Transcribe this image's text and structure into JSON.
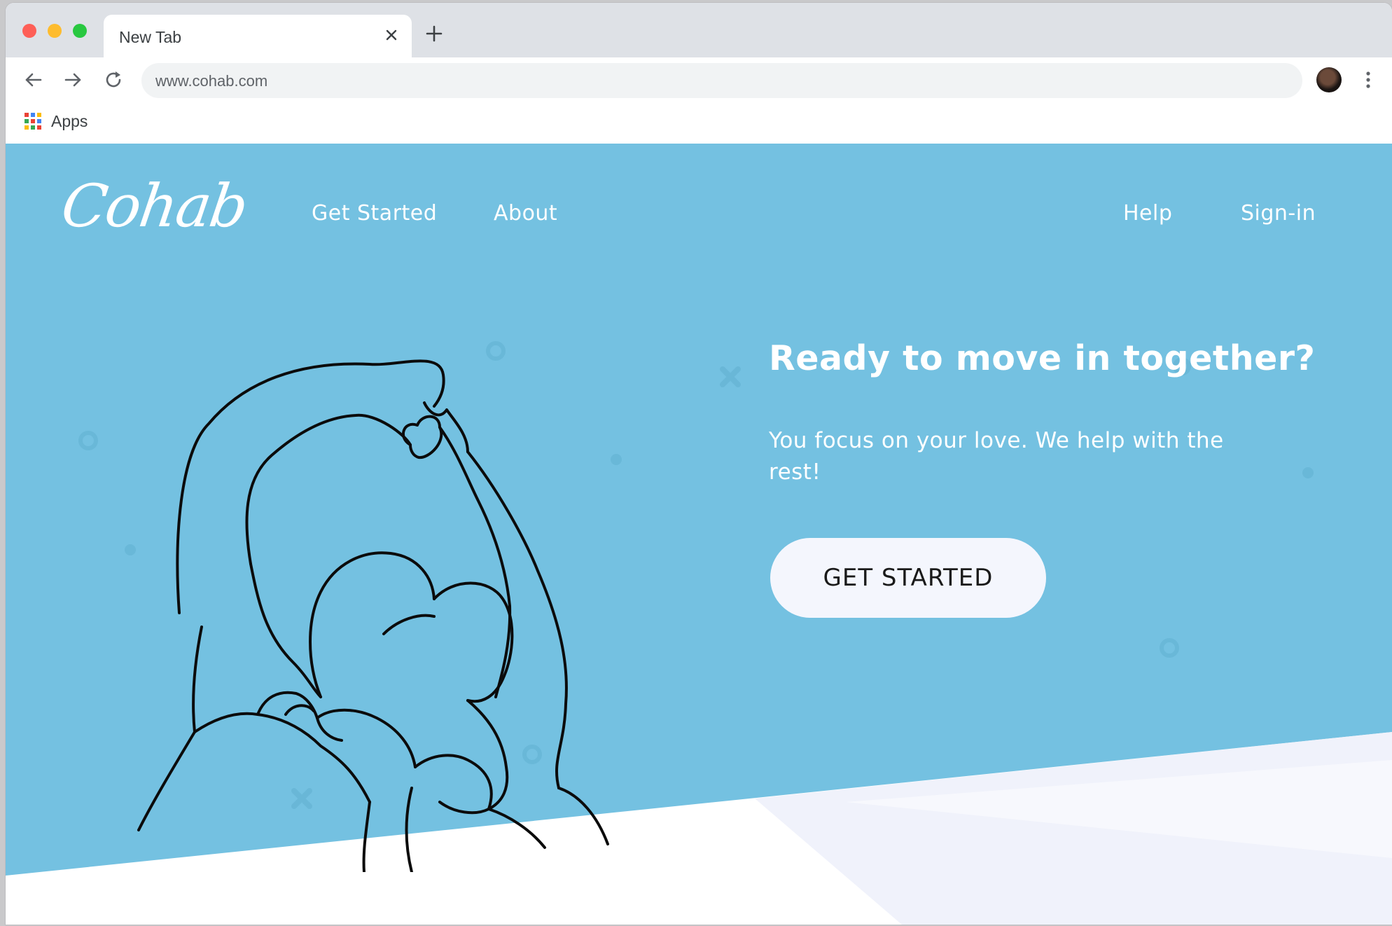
{
  "browser": {
    "tab_title": "New Tab",
    "url": "www.cohab.com",
    "bookmarks_label": "Apps"
  },
  "site": {
    "logo": "Cohab",
    "nav": {
      "get_started": "Get Started",
      "about": "About",
      "help": "Help",
      "sign_in": "Sign-in"
    },
    "hero": {
      "headline": "Ready to move in together?",
      "subtext": "You focus on your love. We help with the rest!",
      "cta_label": "GET STARTED"
    }
  },
  "colors": {
    "hero_blue": "#74c1e1",
    "cta_background": "#f4f6fd",
    "tabstrip": "#dee1e6"
  },
  "icons": [
    "close-icon",
    "plus-icon",
    "back-arrow-icon",
    "forward-arrow-icon",
    "reload-icon",
    "profile-avatar",
    "kebab-menu-icon",
    "apps-grid-icon"
  ]
}
